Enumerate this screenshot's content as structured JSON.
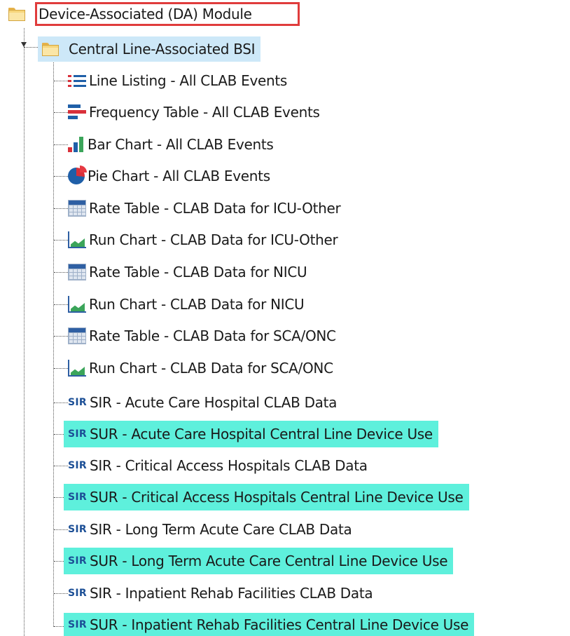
{
  "tree": {
    "root": {
      "label": "Device-Associated (DA) Module",
      "icon": "folder-icon"
    },
    "category": {
      "label": "Central Line-Associated BSI",
      "icon": "folder-icon"
    },
    "items": [
      {
        "label": "Line Listing - All CLAB Events",
        "icon": "line-listing-icon"
      },
      {
        "label": "Frequency Table - All CLAB Events",
        "icon": "frequency-table-icon"
      },
      {
        "label": "Bar Chart - All CLAB Events",
        "icon": "bar-chart-icon"
      },
      {
        "label": "Pie Chart - All CLAB Events",
        "icon": "pie-chart-icon"
      },
      {
        "label": "Rate Table - CLAB Data for ICU-Other",
        "icon": "rate-table-icon"
      },
      {
        "label": "Run Chart - CLAB Data for ICU-Other",
        "icon": "run-chart-icon"
      },
      {
        "label": "Rate Table - CLAB Data for NICU",
        "icon": "rate-table-icon"
      },
      {
        "label": "Run Chart - CLAB Data for NICU",
        "icon": "run-chart-icon"
      },
      {
        "label": "Rate Table - CLAB Data for SCA/ONC",
        "icon": "rate-table-icon"
      },
      {
        "label": "Run Chart - CLAB Data for SCA/ONC",
        "icon": "run-chart-icon"
      },
      {
        "label": "SIR - Acute Care Hospital CLAB Data",
        "icon": "sir-icon",
        "badge": "SIR"
      },
      {
        "label": "SUR - Acute Care Hospital Central Line Device Use",
        "icon": "sir-icon",
        "badge": "SIR",
        "highlight": "#5ef0dc"
      },
      {
        "label": "SIR - Critical Access Hospitals CLAB Data",
        "icon": "sir-icon",
        "badge": "SIR"
      },
      {
        "label": "SUR - Critical Access Hospitals Central Line Device Use",
        "icon": "sir-icon",
        "badge": "SIR",
        "highlight": "#5ef0dc"
      },
      {
        "label": "SIR - Long Term Acute Care CLAB Data",
        "icon": "sir-icon",
        "badge": "SIR"
      },
      {
        "label": "SUR - Long Term Acute Care Central Line Device Use",
        "icon": "sir-icon",
        "badge": "SIR",
        "highlight": "#5ef0dc"
      },
      {
        "label": "SIR - Inpatient Rehab Facilities CLAB Data",
        "icon": "sir-icon",
        "badge": "SIR"
      },
      {
        "label": "SUR - Inpatient Rehab Facilities Central Line Device Use",
        "icon": "sir-icon",
        "badge": "SIR",
        "highlight": "#5ef0dc"
      }
    ]
  },
  "colors": {
    "selection_border": "#e03c3c",
    "category_highlight": "#cde8f8",
    "sur_highlight": "#5ef0dc",
    "sir_text": "#1c4f96"
  }
}
